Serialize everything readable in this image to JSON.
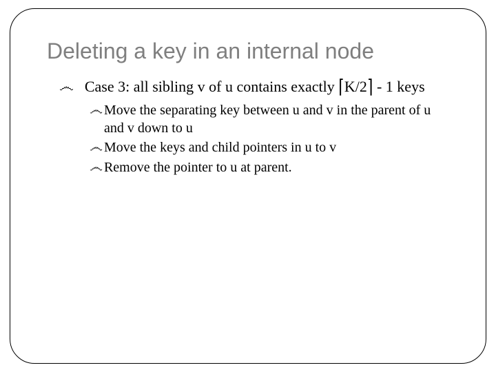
{
  "title": "Deleting a key in an internal node",
  "bullet_glyph": "෴",
  "case3": {
    "prefix": "Case 3: all sibling v of u contains exactly",
    "ceil_open": "⌈",
    "ceil_expr": "K/2",
    "ceil_close": "⌉",
    "suffix": "- 1 keys"
  },
  "sub": [
    "Move the separating key between u and v in the parent of u and v down to u",
    "Move the keys and child pointers in u to v",
    "Remove the pointer to u at parent."
  ]
}
